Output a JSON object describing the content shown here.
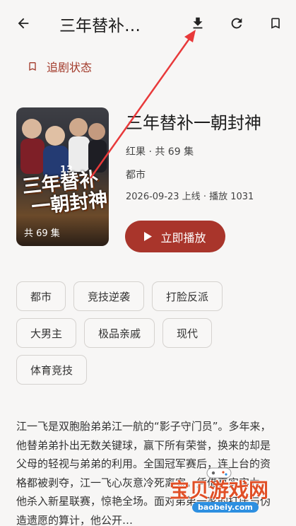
{
  "header": {
    "title": "三年替补…",
    "back_icon": "arrow-left-icon",
    "download_icon": "download-icon",
    "refresh_icon": "refresh-icon",
    "bookmark_icon": "bookmark-icon"
  },
  "follow": {
    "label": "追剧状态",
    "icon": "bookmark-outline-icon"
  },
  "poster": {
    "title_line1": "三年替补",
    "title_line2": "一朝封神",
    "episodes": "共 69 集"
  },
  "drama": {
    "name": "三年替补一朝封神",
    "source": "红果 · 共 69 集",
    "genre": "都市",
    "release": "2026-09-23 上线 · 播放 1031",
    "play_label": "立即播放"
  },
  "tags": [
    "都市",
    "竞技逆袭",
    "打脸反派",
    "大男主",
    "极品亲戚",
    "现代",
    "体育竞技"
  ],
  "description": "江一飞是双胞胎弟弟江一航的“影子守门员”。多年来，他替弟弟扑出无数关键球，赢下所有荣誉，换来的却是父母的轻视与弟弟的利用。全国冠军赛后，连上台的资格都被剥夺，江一飞心灰意冷死离家。凭借真实实力，他杀入新星联赛，惊艳全场。面对弟弟一家的打压与伪造遗愿的算计，他公开…",
  "watermark": {
    "text": "宝贝游戏网",
    "url": "baobeiy.com"
  },
  "colors": {
    "accent": "#a9352b",
    "annotation_arrow": "#e8393a",
    "background": "#f7f6f5"
  }
}
